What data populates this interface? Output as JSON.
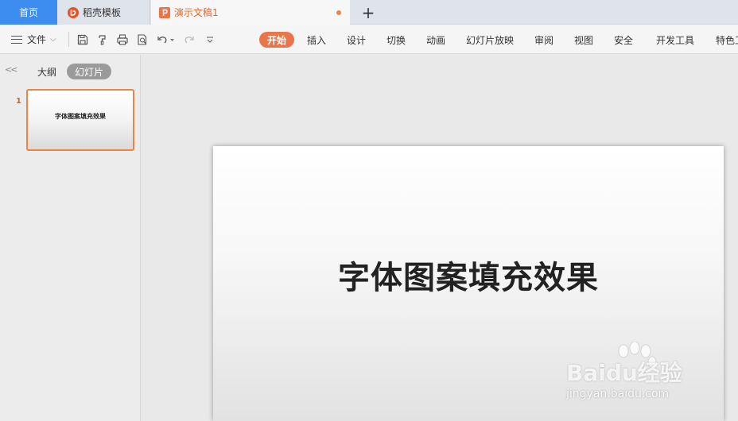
{
  "tabs": {
    "home": "首页",
    "template": "稻壳模板",
    "doc": "演示文稿1",
    "add": "+"
  },
  "toolbar": {
    "file_menu": "文件",
    "ribbon": [
      "开始",
      "插入",
      "设计",
      "切换",
      "动画",
      "幻灯片放映",
      "审阅",
      "视图",
      "安全",
      "开发工具",
      "特色工"
    ]
  },
  "left_panel": {
    "collapse": "<<",
    "outline_tab": "大纲",
    "slides_tab": "幻灯片",
    "slides": [
      {
        "number": "1",
        "title": "字体图案填充效果"
      }
    ]
  },
  "slide": {
    "title": "字体图案填充效果"
  },
  "watermark": {
    "brand": "Baidu经验",
    "url": "jingyan.baidu.com"
  },
  "colors": {
    "home_tab": "#3d8cf0",
    "accent": "#e8764a",
    "doc_tab_text": "#e06a2b"
  },
  "icons": [
    "menu-icon",
    "save-icon",
    "format-painter-icon",
    "print-icon",
    "print-preview-icon",
    "undo-icon",
    "redo-icon",
    "more-icon",
    "docer-icon",
    "presentation-icon"
  ]
}
